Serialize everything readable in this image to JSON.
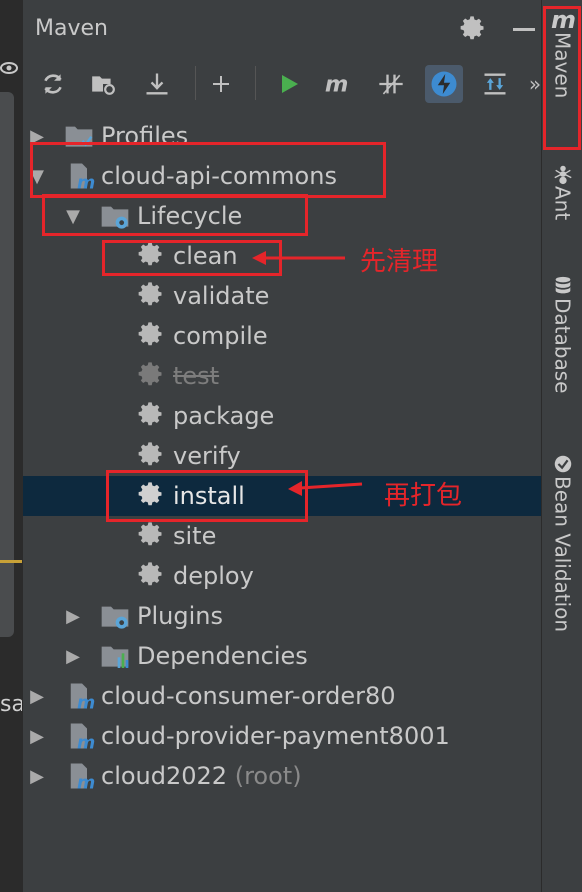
{
  "panel": {
    "title": "Maven",
    "toolbar_more": "»"
  },
  "tree": {
    "items": [
      {
        "label": "Profiles"
      },
      {
        "label": "cloud-api-commons"
      },
      {
        "label": "Lifecycle"
      },
      {
        "label": "clean"
      },
      {
        "label": "validate"
      },
      {
        "label": "compile"
      },
      {
        "label": "test"
      },
      {
        "label": "package"
      },
      {
        "label": "verify"
      },
      {
        "label": "install"
      },
      {
        "label": "site"
      },
      {
        "label": "deploy"
      },
      {
        "label": "Plugins"
      },
      {
        "label": "Dependencies"
      },
      {
        "label": "cloud-consumer-order80"
      },
      {
        "label": "cloud-provider-payment8001"
      },
      {
        "label": "cloud2022",
        "suffix": "(root)"
      }
    ]
  },
  "right_tabs": {
    "maven": "Maven",
    "ant": "Ant",
    "database": "Database",
    "bean_validation": "Bean Validation"
  },
  "annotations": {
    "clean_note": "先清理",
    "install_note": "再打包"
  },
  "left_strip": {
    "fragment": "sa"
  },
  "colors": {
    "annotation_red": "#e5252a",
    "selection": "#0d293e",
    "run_green": "#4aaf4f",
    "panel_bg": "#3c3f41"
  }
}
